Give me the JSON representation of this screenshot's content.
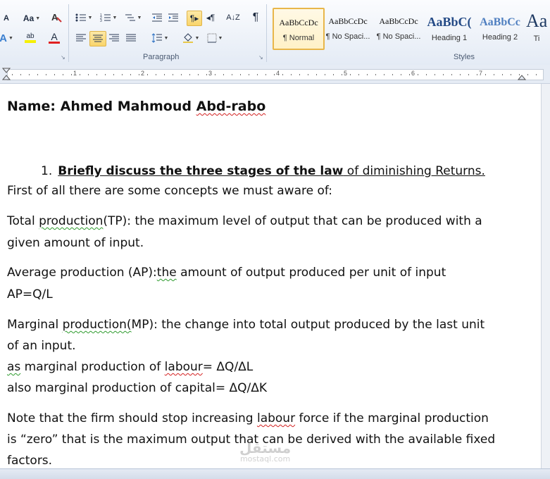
{
  "ribbon": {
    "paragraph_label": "Paragraph",
    "styles_label": "Styles",
    "font_buttons": {
      "font_size_dec": "A",
      "change_case": "Aa",
      "text_effect": "A",
      "highlight": "ab",
      "font_color": "A"
    },
    "pilcrow": "¶",
    "styles": [
      {
        "preview": "AaBbCcDc",
        "name": "¶ Normal",
        "selected": true
      },
      {
        "preview": "AaBbCcDc",
        "name": "¶ No Spaci...",
        "selected": false
      },
      {
        "preview": "AaBbCcDc",
        "name": "¶ No Spaci...",
        "selected": false
      },
      {
        "preview": "AaBbC(",
        "name": "Heading 1",
        "selected": false
      },
      {
        "preview": "AaBbCc",
        "name": "Heading 2",
        "selected": false
      },
      {
        "preview": "Aa",
        "name": "Ti",
        "selected": false
      }
    ]
  },
  "ruler": {
    "numbers": [
      "1",
      "2",
      "3",
      "4",
      "5",
      "6",
      "7"
    ]
  },
  "document": {
    "name_prefix": "Name: Ahmed Mahmoud ",
    "name_surname": "Abd-rabo",
    "q1_number": "1.",
    "q1_strong": "Briefly discuss  the three stages of the law",
    "q1_rest": " of diminishing Returns.",
    "intro": "First of all there are some concepts we must aware of:",
    "tp_a": "Total ",
    "tp_b": "production",
    "tp_c": "(TP):  the maximum level of output that can be produced with a",
    "tp_line2": "given amount of input.",
    "ap_a": "Average production (AP):",
    "ap_b": "the",
    "ap_c": " amount of output produced per unit of input",
    "ap_formula": "AP=Q/L",
    "mp_a": "Marginal ",
    "mp_b": "production(",
    "mp_c": "MP):  the change into total output produced by the last unit",
    "mp_line2": "of an input.",
    "lab_a": "as",
    "lab_b": " marginal production  of ",
    "lab_c": "labour",
    "lab_d": "= ΔQ/ΔL",
    "cap_line": "also marginal production  of capital= ΔQ/ΔK",
    "note_a": "Note that the firm should stop increasing ",
    "note_b": "labour",
    "note_c": " force if the marginal production",
    "note_line2": "is “zero”  that is the maximum output that can be derived with the available fixed",
    "note_line3": "factors."
  },
  "watermark": {
    "arabic": "مستقل",
    "latin": "mostaql.com"
  },
  "colors": {
    "accent_selected": "#e8b64a",
    "spell_error": "#d32020",
    "grammar_error": "#2e9b2e"
  }
}
